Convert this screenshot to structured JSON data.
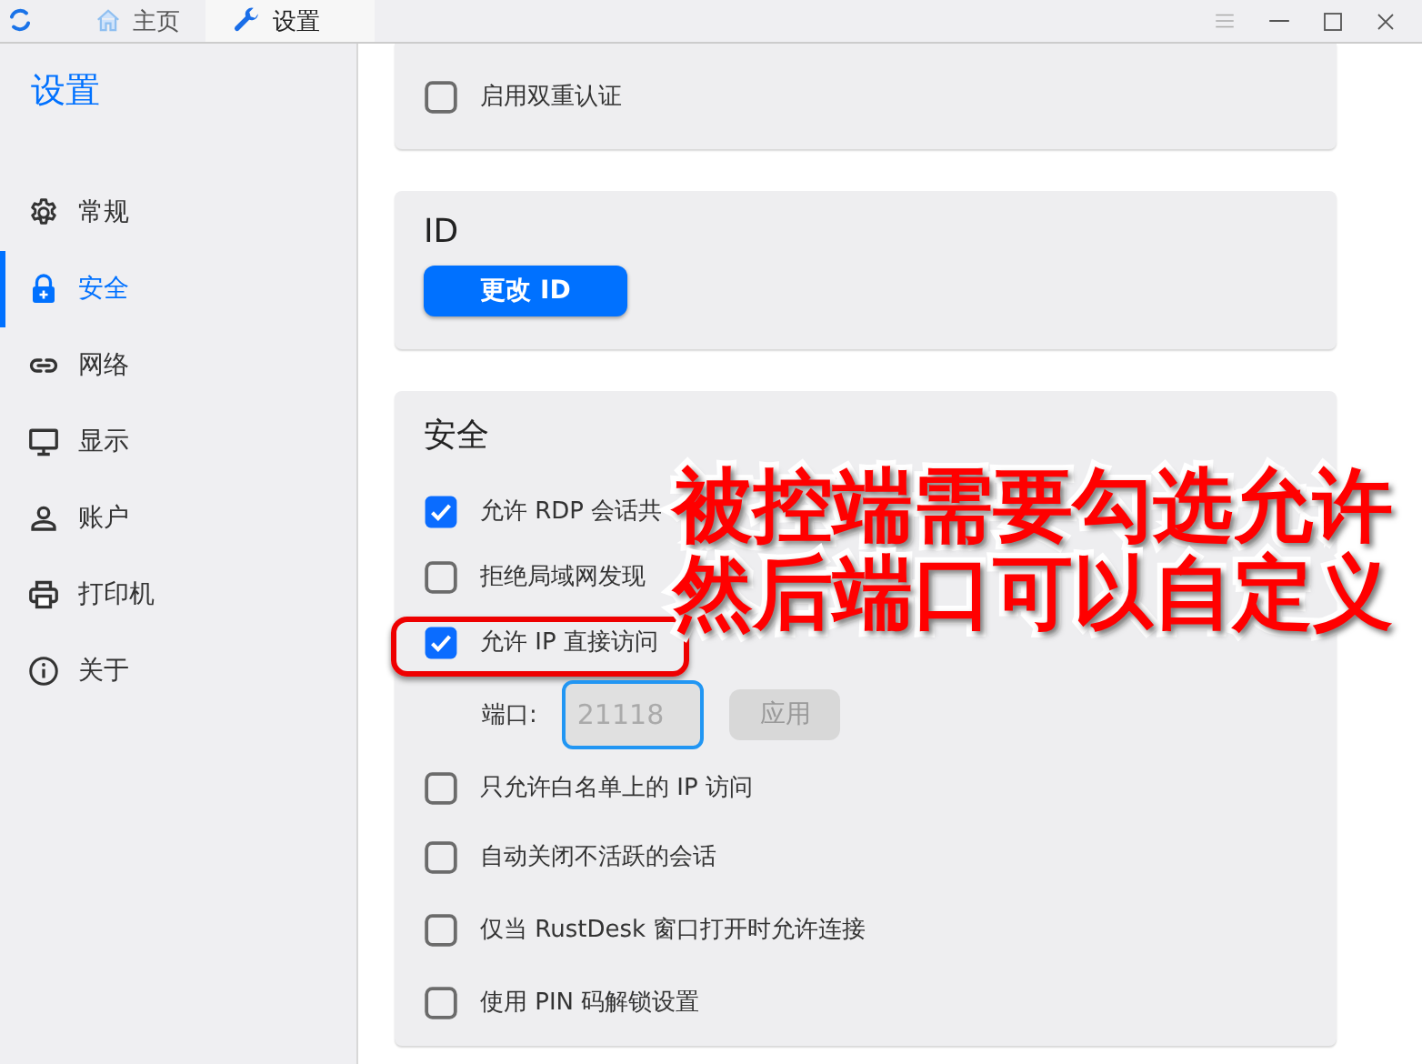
{
  "tabs": [
    {
      "label": "主页",
      "selected": false
    },
    {
      "label": "设置",
      "selected": true
    }
  ],
  "sidebar": {
    "title": "设置",
    "items": [
      {
        "label": "常规",
        "selected": false
      },
      {
        "label": "安全",
        "selected": true
      },
      {
        "label": "网络",
        "selected": false
      },
      {
        "label": "显示",
        "selected": false
      },
      {
        "label": "账户",
        "selected": false
      },
      {
        "label": "打印机",
        "selected": false
      },
      {
        "label": "关于",
        "selected": false
      }
    ]
  },
  "two_factor": {
    "label": "启用双重认证",
    "checked": false
  },
  "id_section": {
    "title": "ID",
    "button": "更改 ID"
  },
  "security_section": {
    "title": "安全",
    "options": [
      {
        "kind": "checkbox",
        "label": "允许 RDP 会话共",
        "checked": true,
        "highlighted": false
      },
      {
        "kind": "checkbox",
        "label": "拒绝局域网发现",
        "checked": false,
        "highlighted": false
      },
      {
        "kind": "checkbox",
        "label": "允许 IP 直接访问",
        "checked": true,
        "highlighted": true
      },
      {
        "kind": "port",
        "label": "端口:",
        "placeholder": "21118",
        "button": "应用",
        "disabled": true
      },
      {
        "kind": "checkbox",
        "label": "只允许白名单上的 IP 访问",
        "checked": false,
        "highlighted": false
      },
      {
        "kind": "checkbox",
        "label": "自动关闭不活跃的会话",
        "checked": false,
        "highlighted": false
      },
      {
        "kind": "checkbox",
        "label": "仅当 RustDesk 窗口打开时允许连接",
        "checked": false,
        "highlighted": false
      },
      {
        "kind": "checkbox",
        "label": "使用 PIN 码解锁设置",
        "checked": false,
        "highlighted": false
      }
    ]
  },
  "annotation": {
    "lines": [
      "被控端需要勾选允许",
      "然后端口可以自定义"
    ]
  }
}
